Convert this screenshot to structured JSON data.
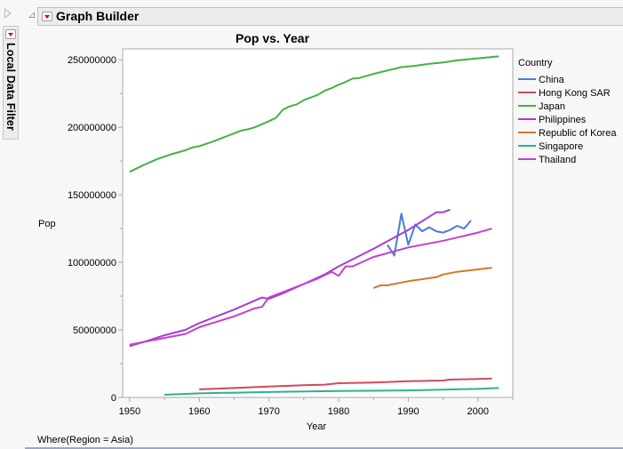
{
  "window": {
    "header_title": "Graph Builder",
    "local_data_filter_label": "Local Data Filter",
    "where_clause": "Where(Region = Asia)"
  },
  "chart_data": {
    "type": "line",
    "title": "Pop vs. Year",
    "xlabel": "Year",
    "ylabel": "Pop",
    "xlim": [
      1949,
      2005
    ],
    "ylim": [
      0,
      258000000
    ],
    "xticks": [
      1950,
      1960,
      1970,
      1980,
      1990,
      2000
    ],
    "xtick_labels": [
      "1950",
      "1960",
      "1970",
      "1980",
      "1990",
      "2000"
    ],
    "yticks": [
      0,
      50000000,
      100000000,
      150000000,
      200000000,
      250000000
    ],
    "ytick_labels": [
      "0",
      "50000000",
      "100000000",
      "150000000",
      "200000000",
      "250000000"
    ],
    "grid": false,
    "legend_title": "Country",
    "legend_position": "right",
    "series": [
      {
        "name": "China",
        "color": "#4a7bdc",
        "x": [
          1987,
          1988,
          1989,
          1990,
          1991,
          1992,
          1993,
          1994,
          1995,
          1996,
          1997,
          1998,
          1999
        ],
        "y": [
          113000000,
          105000000,
          136000000,
          113000000,
          128000000,
          123000000,
          126000000,
          123000000,
          122000000,
          124000000,
          127000000,
          125000000,
          131000000
        ]
      },
      {
        "name": "Hong Kong SAR",
        "color": "#d1495b",
        "x": [
          1960,
          1965,
          1970,
          1975,
          1978,
          1980,
          1985,
          1990,
          1995,
          1996,
          2000,
          2002
        ],
        "y": [
          6000000,
          7000000,
          8000000,
          9000000,
          9500000,
          10500000,
          11000000,
          12000000,
          12500000,
          13200000,
          13600000,
          14000000
        ]
      },
      {
        "name": "Japan",
        "color": "#44b144",
        "x": [
          1950,
          1952,
          1954,
          1956,
          1958,
          1959,
          1960,
          1962,
          1964,
          1966,
          1967,
          1968,
          1970,
          1971,
          1972,
          1973,
          1974,
          1975,
          1977,
          1978,
          1979,
          1980,
          1981,
          1982,
          1983,
          1985,
          1987,
          1989,
          1991,
          1993,
          1995,
          1997,
          1999,
          2001,
          2003
        ],
        "y": [
          167000000,
          172000000,
          176500000,
          180000000,
          183000000,
          185000000,
          186000000,
          189500000,
          193500000,
          197500000,
          198500000,
          200000000,
          204500000,
          207000000,
          213000000,
          215500000,
          217000000,
          220000000,
          224000000,
          227000000,
          229000000,
          231500000,
          233500000,
          236000000,
          236500000,
          239500000,
          242000000,
          244500000,
          245500000,
          247000000,
          248000000,
          249500000,
          250500000,
          251500000,
          252500000
        ]
      },
      {
        "name": "Philippines",
        "color": "#a23ed8",
        "x": [
          1950,
          1952,
          1955,
          1958,
          1960,
          1965,
          1969,
          1970,
          1972,
          1975,
          1978,
          1980,
          1985,
          1990,
          1994,
          1995,
          1996
        ],
        "y": [
          38000000,
          41000000,
          46000000,
          50000000,
          55000000,
          65000000,
          74000000,
          73000000,
          77000000,
          84000000,
          91000000,
          97000000,
          110000000,
          124000000,
          137000000,
          137000000,
          139000000
        ]
      },
      {
        "name": "Republic of Korea",
        "color": "#d4782a",
        "x": [
          1985,
          1986,
          1987,
          1990,
          1994,
          1995,
          1997,
          2002
        ],
        "y": [
          81000000,
          83000000,
          83000000,
          86000000,
          89000000,
          91000000,
          93000000,
          96000000
        ]
      },
      {
        "name": "Singapore",
        "color": "#2cb38b",
        "x": [
          1955,
          1960,
          1970,
          1980,
          1990,
          2000,
          2003
        ],
        "y": [
          2000000,
          3000000,
          4000000,
          4800000,
          5200000,
          6300000,
          7000000
        ]
      },
      {
        "name": "Thailand",
        "color": "#c63fd0",
        "x": [
          1950,
          1955,
          1958,
          1960,
          1965,
          1968,
          1969,
          1970,
          1972,
          1975,
          1977,
          1979,
          1980,
          1981,
          1982,
          1985,
          1990,
          1995,
          2000,
          2002
        ],
        "y": [
          39000000,
          44000000,
          47000000,
          52000000,
          60000000,
          66000000,
          67000000,
          74000000,
          78000000,
          84000000,
          88000000,
          93000000,
          90000000,
          97000000,
          97000000,
          104000000,
          111000000,
          116000000,
          122000000,
          125000000
        ]
      }
    ]
  }
}
